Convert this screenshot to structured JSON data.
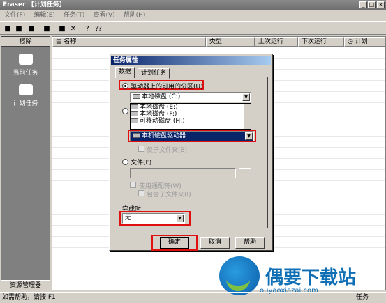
{
  "window": {
    "title": "Eraser 【计划任务】",
    "btn_min": "_",
    "btn_max": "□",
    "btn_close": "×"
  },
  "menu": [
    "文件(F)",
    "编辑(E)",
    "任务(T)",
    "查看(V)",
    "帮助(H)"
  ],
  "sidebar": {
    "header": "擦除",
    "items": [
      "当前任务",
      "计划任务"
    ],
    "footer": "资源管理器"
  },
  "columns": {
    "name": "名称",
    "type": "类型",
    "last_run": "上次运行",
    "next_run": "下次运行",
    "schedule": "计划"
  },
  "status": {
    "help": "如需帮助，请按 F1",
    "right": "任务"
  },
  "dialog": {
    "title": "任务属性",
    "tabs": [
      "数据",
      "计划任务"
    ],
    "radio_partition": "驱动器上的可用的分区(U)",
    "partition_value": "本地磁盘 (C:)",
    "list_items": [
      "本地磁盘 (E:)",
      "本地磁盘 (F:)",
      "可移动磁盘 (H:)"
    ],
    "list_selected": "本机硬盘驱动器",
    "subfolder_only": "仅子文件夹(B)",
    "radio_file": "文件(F)",
    "browse": "...",
    "use_wildcard": "使用通配符(W)",
    "include_subfolders": "包含子文件夹(I)",
    "on_complete_label": "完成时",
    "on_complete_value": "无",
    "ok": "确定",
    "cancel": "取消",
    "help": "帮助"
  },
  "watermark": {
    "text": "偶要下载站",
    "url": "ouyaoxiazai.com"
  }
}
